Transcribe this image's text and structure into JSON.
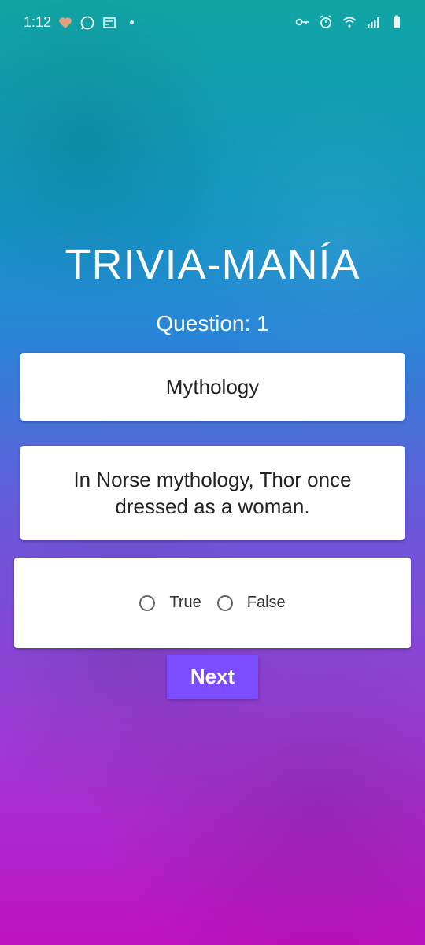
{
  "status_bar": {
    "time": "1:12",
    "left_icons": [
      "health-icon",
      "whatsapp-icon",
      "news-icon"
    ],
    "right_icons": [
      "key-icon",
      "alarm-icon",
      "wifi-icon",
      "signal-icon",
      "battery-icon"
    ]
  },
  "app": {
    "title": "TRIVIA-MANÍA",
    "question_label": "Question: 1",
    "category": "Mythology",
    "question": "In Norse mythology, Thor once dressed as a woman.",
    "options": [
      "True",
      "False"
    ],
    "next_label": "Next"
  },
  "colors": {
    "accent": "#7c4dff",
    "background_top": "#10a5a4",
    "background_bottom": "#c011c2",
    "card": "#ffffff"
  }
}
